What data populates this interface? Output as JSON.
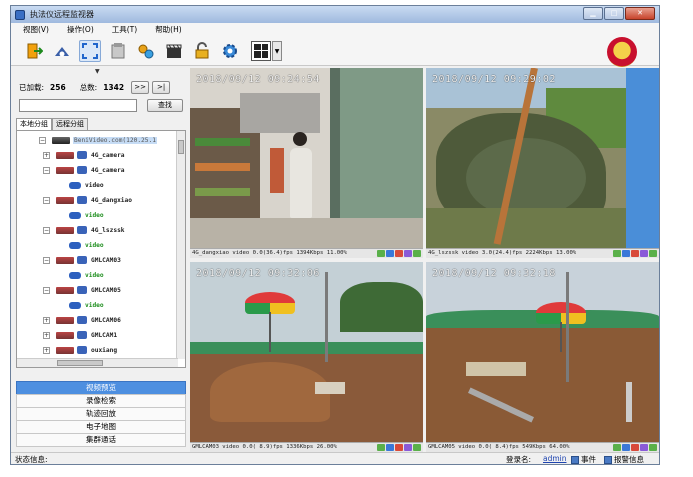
{
  "window": {
    "title": "执法仪远程监视器"
  },
  "menu": [
    {
      "label": "视图(V)"
    },
    {
      "label": "操作(O)"
    },
    {
      "label": "工具(T)"
    },
    {
      "label": "帮助(H)"
    }
  ],
  "toolbar": {
    "icons": [
      "exit-icon",
      "cloud-connect-icon",
      "fullscreen-icon",
      "document-icon",
      "settings-gears-icon",
      "record-clapper-icon",
      "lock-icon",
      "config-gear-icon"
    ]
  },
  "left": {
    "loaded_label": "已加载:",
    "loaded_value": "256",
    "total_label": "总数:",
    "total_value": "1342",
    "next_btn": ">>",
    "last_btn": ">|",
    "search_placeholder": "",
    "search_btn": "查找",
    "tabs": [
      "本地分组",
      "远程分组"
    ],
    "tree": [
      {
        "level": 0,
        "expander": "⊟",
        "type": "root",
        "label": "BeniVideo.com(120.25.1"
      },
      {
        "level": 1,
        "expander": "⊞",
        "type": "device",
        "label": "4G_camera"
      },
      {
        "level": 1,
        "expander": "⊟",
        "type": "device",
        "label": "4G_camera"
      },
      {
        "level": 2,
        "expander": "",
        "type": "channel",
        "label": "video",
        "green": false
      },
      {
        "level": 1,
        "expander": "⊟",
        "type": "device",
        "label": "4G_dangxiao"
      },
      {
        "level": 2,
        "expander": "",
        "type": "channel",
        "label": "video",
        "green": true
      },
      {
        "level": 1,
        "expander": "⊟",
        "type": "device",
        "label": "4G_lszssk"
      },
      {
        "level": 2,
        "expander": "",
        "type": "channel",
        "label": "video",
        "green": true
      },
      {
        "level": 1,
        "expander": "⊟",
        "type": "device",
        "label": "GMLCAM03"
      },
      {
        "level": 2,
        "expander": "",
        "type": "channel",
        "label": "video",
        "green": true
      },
      {
        "level": 1,
        "expander": "⊟",
        "type": "device",
        "label": "GMLCAM05"
      },
      {
        "level": 2,
        "expander": "",
        "type": "channel",
        "label": "video",
        "green": true
      },
      {
        "level": 1,
        "expander": "⊞",
        "type": "device",
        "label": "GMLCAM06"
      },
      {
        "level": 1,
        "expander": "⊞",
        "type": "device",
        "label": "GMLCAM1"
      },
      {
        "level": 1,
        "expander": "⊞",
        "type": "device",
        "label": "ouxiang"
      }
    ],
    "nav": [
      {
        "label": "视频预览",
        "selected": true
      },
      {
        "label": "录像检索",
        "selected": false
      },
      {
        "label": "轨迹回放",
        "selected": false
      },
      {
        "label": "电子地图",
        "selected": false
      },
      {
        "label": "集群通话",
        "selected": false
      }
    ]
  },
  "videos": [
    {
      "timestamp": "2018/09/12 09:24:54",
      "status": "4G_dangxiao video  0.0(36.4)fps 1394Kbps 11.00%"
    },
    {
      "timestamp": "2018/09/12 09:29:02",
      "status": "4G_lszssk video  3.0(24.4)fps 2224Kbps 13.00%"
    },
    {
      "timestamp": "2018/09/12 09:32:06",
      "status": "GMLCAM03 video  0.0( 8.9)fps 1336Kbps 26.00%"
    },
    {
      "timestamp": "2018/09/12 09:32:18",
      "status": "GMLCAM05 video  0.0( 8.4)fps 549Kbps 64.00%"
    }
  ],
  "statusbar": {
    "status_label": "状态信息:",
    "login_label": "登录名:",
    "login_user": "admin",
    "event_label": "事件",
    "alarm_label": "报警信息"
  },
  "colors": {
    "accent": "#4d8fe0",
    "active_channel": "#1f8f1f",
    "link": "#1e44b0"
  }
}
